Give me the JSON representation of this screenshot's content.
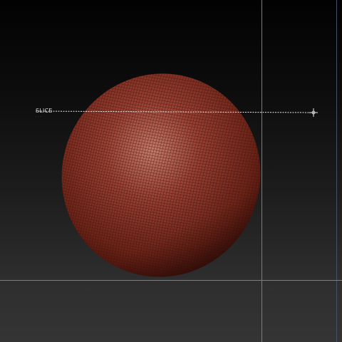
{
  "viewport": {
    "background_top": "#020202",
    "background_bottom": "#343434"
  },
  "guides": {
    "vertical_color": "#6f7aa8",
    "horizontal_color": "#6f8a74",
    "secondary_vertical_color": "#4a4f66"
  },
  "mesh": {
    "base_color": "#8a3428",
    "highlight_color": "#c9806e",
    "shadow_color": "#3a0d08",
    "wire_color": "#4a130c"
  },
  "slice_tool": {
    "label": "SLICE",
    "sublabel": "· · ·",
    "line_color": "#e8e8e8",
    "label_color": "#d8d8d8",
    "handle_icon": "crosshair-handle"
  }
}
